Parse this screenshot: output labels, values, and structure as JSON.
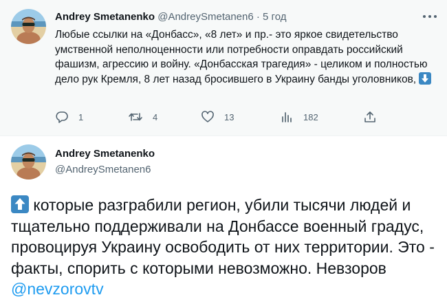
{
  "tweet1": {
    "author_name": "Andrey Smetanenko",
    "handle": "@AndreySmetanen6",
    "separator": "·",
    "time": "5 год",
    "text": "Любые ссылки на «Донбасс», «8 лет» и пр.- это яркое свидетельство умственной неполноценности или потребности оправдать российский фашизм, агрессию и войну. «Донбасская трагедия» - целиком и полностью дело рук Кремля, 8 лет назад бросившего в Украину банды уголовников,",
    "trailing_emoji": "down-arrow-emoji",
    "actions": {
      "replies": "1",
      "retweets": "4",
      "likes": "13",
      "views": "182"
    }
  },
  "tweet2": {
    "author_name": "Andrey Smetanenko",
    "handle": "@AndreySmetanen6",
    "leading_emoji": "up-arrow-emoji",
    "text": "которые разграбили регион, убили  тысячи людей и тщательно поддерживали на Донбассе военный градус, провоцируя Украину освободить от них территории. Это - факты, спорить с которыми невозможно.  Невзоров",
    "mention": "@nevzorovtv"
  },
  "colors": {
    "text_primary": "#0f1419",
    "text_secondary": "#536471",
    "link": "#1d9bf0",
    "emoji_blue": "#3b88c3",
    "parent_background": "#f7f9f9"
  },
  "icons": [
    "reply-icon",
    "retweet-icon",
    "like-icon",
    "views-icon",
    "share-icon",
    "more-icon"
  ]
}
